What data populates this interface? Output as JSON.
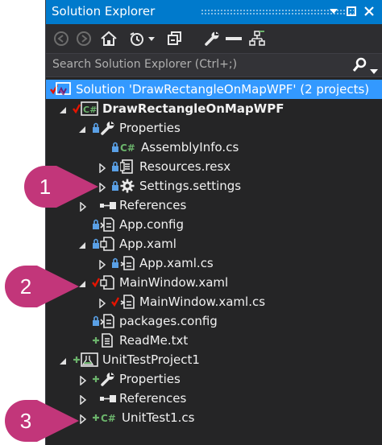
{
  "window": {
    "title": "Solution Explorer"
  },
  "search": {
    "placeholder": "Search Solution Explorer (Ctrl+;)"
  },
  "toolbar": {
    "items": [
      "back-icon",
      "forward-icon",
      "home-icon",
      "history-icon",
      "collapse-all-icon",
      "properties-wrench-icon",
      "minus-icon",
      "view-switch-icon"
    ]
  },
  "tree": {
    "solution": "Solution 'DrawRectangleOnMapWPF' (2 projects)",
    "project1": "DrawRectangleOnMapWPF",
    "properties1": "Properties",
    "assemblyinfo": "AssemblyInfo.cs",
    "resources": "Resources.resx",
    "settings": "Settings.settings",
    "references1": "References",
    "appconfig": "App.config",
    "appxaml": "App.xaml",
    "appxamlcs": "App.xaml.cs",
    "mainwindow": "MainWindow.xaml",
    "mainwindowcs": "MainWindow.xaml.cs",
    "packages": "packages.config",
    "readme": "ReadMe.txt",
    "project2": "UnitTestProject1",
    "properties2": "Properties",
    "references2": "References",
    "unittest": "UnitTest1.cs"
  },
  "callouts": [
    "1",
    "2",
    "3"
  ],
  "colors": {
    "accent": "#007acc",
    "selection": "#3399ff",
    "callout": "#c2367a",
    "background": "#252526",
    "checkmark_red": "#e51400",
    "plus_green": "#6bb36b",
    "lock_blue": "#5aa0e6"
  }
}
